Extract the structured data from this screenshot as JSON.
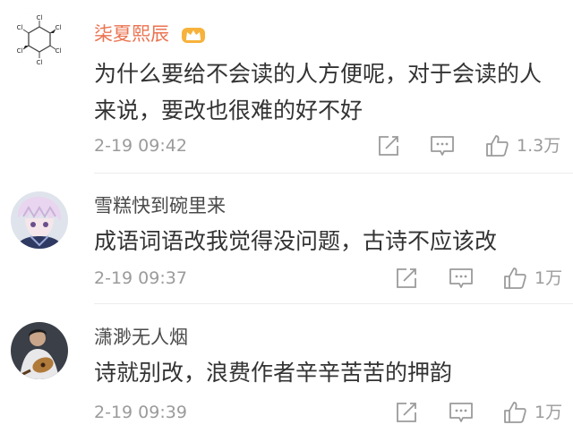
{
  "comments": [
    {
      "username": "柒夏熙辰",
      "verified_badge": "crown-vip-icon",
      "text": "为什么要给不会读的人方便呢，对于会读的人来说，要改也很难的好不好",
      "time": "2-19 09:42",
      "likes": "1.3万",
      "avatar": "chemical-structure-avatar",
      "avatar_atoms": [
        "Cl",
        "Cl",
        "Cl",
        "Cl",
        "Cl",
        "Cl"
      ]
    },
    {
      "username": "雪糕快到碗里来",
      "text": "成语词语改我觉得没问题，古诗不应该改",
      "time": "2-19 09:37",
      "likes": "1万",
      "avatar": "anime-character-avatar"
    },
    {
      "username": "潇渺无人烟",
      "text": "诗就别改，浪费作者辛辛苦苦的押韵",
      "time": "2-19 09:39",
      "likes": "1万",
      "avatar": "guitar-player-avatar"
    }
  ],
  "colors": {
    "vip_name": "#eb7350",
    "normal_name": "#4a4a4a",
    "text": "#333333",
    "meta": "#9b9b9b",
    "divider": "#ececec"
  },
  "icons": {
    "share": "share-icon",
    "comment": "comment-icon",
    "like": "thumbs-up-icon"
  }
}
